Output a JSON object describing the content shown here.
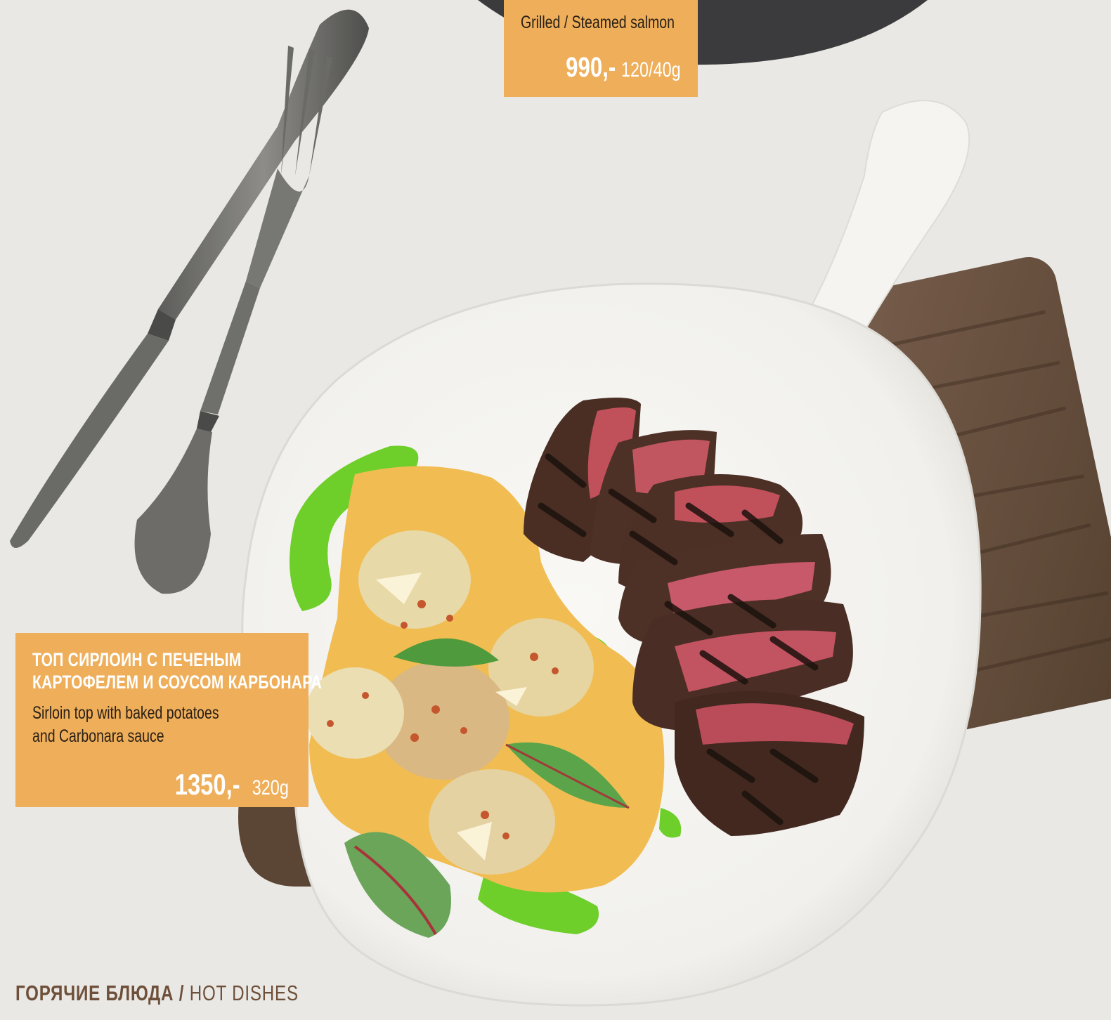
{
  "colors": {
    "tag_background": "#eeae5a",
    "tablecloth": "#e9e8e5",
    "plate": "#f7f6f3",
    "board": "#6b5344",
    "sauce": "#f1bd52",
    "herb_oil": "#6ecf2a",
    "steak_crust": "#4a2e24",
    "steak_rare": "#c0505a",
    "footer_text": "#6e4f39"
  },
  "featured_item": {
    "name": "Grilled / Steamed salmon",
    "price": "990,-",
    "weight": "120/40g"
  },
  "main_item": {
    "name_ru_line1": "ТОП СИРЛОИН С ПЕЧЕНЫМ",
    "name_ru_line2": "КАРТОФЕЛЕМ И СОУСОМ КАРБОНАРА",
    "name_en_line1": "Sirloin top with baked potatoes",
    "name_en_line2": "and Carbonara sauce",
    "price": "1350,-",
    "weight": "320g"
  },
  "section": {
    "title_ru": "ГОРЯЧИЕ БЛЮДА",
    "separator": " / ",
    "title_en": "HOT DISHES"
  }
}
